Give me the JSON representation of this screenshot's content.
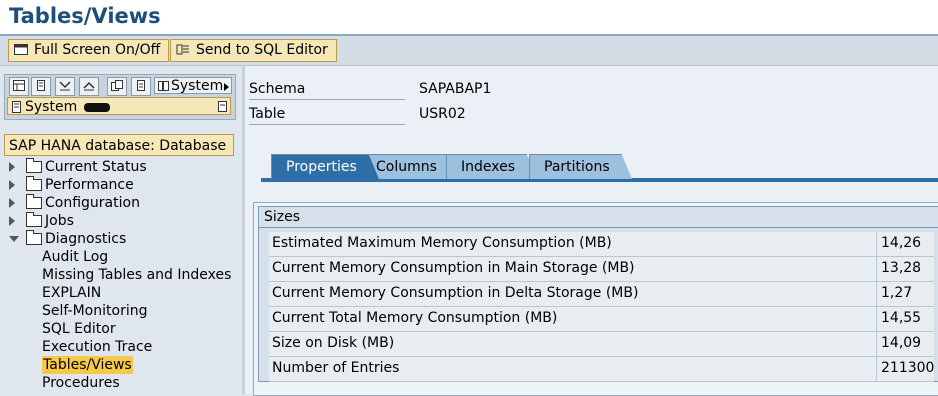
{
  "window": {
    "title": "Tables/Views"
  },
  "toolbar": {
    "fullscreen_label": "Full Screen On/Off",
    "sql_editor_label": "Send to SQL Editor"
  },
  "nav": {
    "system_dropdown": "System",
    "system_label": "System",
    "icons": [
      "list-icon",
      "page-icon",
      "expand-all-icon",
      "collapse-all-icon",
      "find-icon",
      "page-icon"
    ]
  },
  "tree": {
    "header": "SAP HANA database: Database",
    "items": [
      {
        "label": "Current Status",
        "expanded": false
      },
      {
        "label": "Performance",
        "expanded": false
      },
      {
        "label": "Configuration",
        "expanded": false
      },
      {
        "label": "Jobs",
        "expanded": false
      },
      {
        "label": "Diagnostics",
        "expanded": true
      }
    ],
    "subitems": [
      {
        "label": "Audit Log"
      },
      {
        "label": "Missing Tables and Indexes"
      },
      {
        "label": "EXPLAIN"
      },
      {
        "label": "Self-Monitoring"
      },
      {
        "label": "SQL Editor"
      },
      {
        "label": "Execution Trace"
      },
      {
        "label": "Tables/Views",
        "selected": true
      },
      {
        "label": "Procedures"
      }
    ]
  },
  "details": {
    "schema_label": "Schema",
    "schema_value": "SAPABAP1",
    "table_label": "Table",
    "table_value": "USR02"
  },
  "tabs": [
    {
      "label": "Properties",
      "active": true
    },
    {
      "label": "Columns"
    },
    {
      "label": "Indexes"
    },
    {
      "label": "Partitions"
    }
  ],
  "sizes": {
    "title": "Sizes",
    "rows": [
      {
        "label": "Estimated Maximum Memory Consumption (MB)",
        "value": "14,26"
      },
      {
        "label": "Current Memory Consumption in Main Storage (MB)",
        "value": "13,28"
      },
      {
        "label": "Current Memory Consumption in Delta Storage (MB)",
        "value": "1,27"
      },
      {
        "label": "Current Total Memory Consumption (MB)",
        "value": "14,55"
      },
      {
        "label": "Size on Disk (MB)",
        "value": "14,09"
      },
      {
        "label": "Number of Entries",
        "value": "211300"
      }
    ]
  }
}
